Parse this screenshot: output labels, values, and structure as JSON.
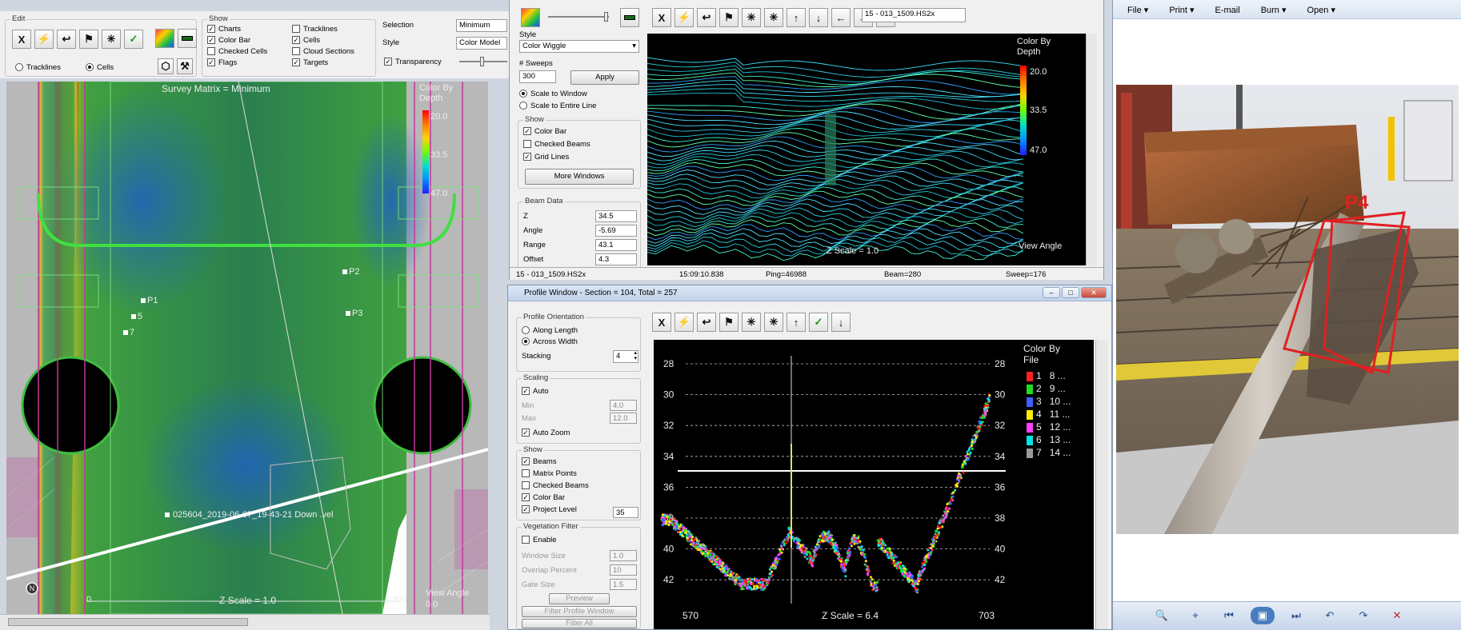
{
  "main_toolbar": {
    "edit_label": "Edit",
    "edit_tools": [
      "X",
      "⚡",
      "↩",
      "⚑",
      "✳",
      "✓"
    ],
    "tracklines_radio": "Tracklines",
    "cells_radio": "Cells",
    "show_label": "Show",
    "show_col1": [
      {
        "label": "Charts",
        "checked": true
      },
      {
        "label": "Color Bar",
        "checked": true
      },
      {
        "label": "Checked Cells",
        "checked": false
      },
      {
        "label": "Flags",
        "checked": true
      }
    ],
    "show_col2": [
      {
        "label": "Tracklines",
        "checked": false
      },
      {
        "label": "Cells",
        "checked": true
      },
      {
        "label": "Cloud Sections",
        "checked": false
      },
      {
        "label": "Targets",
        "checked": true
      }
    ],
    "selection_label": "Selection",
    "selection_value": "Minimum",
    "style_label": "Style",
    "style_value": "Color Model",
    "transparency_label": "Transparency"
  },
  "survey_matrix": {
    "title": "Survey Matrix = Minimum",
    "color_by_title": "Color By\nDepth",
    "colorbar_ticks": [
      "20.0",
      "33.5",
      "47.0"
    ],
    "targets": [
      "P1",
      "P2",
      "P3",
      "5",
      "7"
    ],
    "track_label": "025604_2019-06-07_19-43-21 Down .vel",
    "scale_start": "0",
    "scale_end": "300",
    "z_scale": "Z Scale = 1.0",
    "view_angle_label": "View Angle",
    "view_angle_value": "0.0",
    "north": "N",
    "colors": {
      "seabed": "#2f7a3f",
      "deep": "#1f4fa0",
      "pink_grid": "#c0389a"
    }
  },
  "wiggle_window": {
    "toolbar_tools": [
      "X",
      "⚡",
      "↩",
      "⚑",
      "✳",
      "✳",
      "↑",
      "↓",
      "←",
      "→",
      "⊕"
    ],
    "file_name": "15 - 013_1509.HS2x",
    "style_label": "Style",
    "style_value": "Color Wiggle",
    "sweeps_label": "# Sweeps",
    "sweeps_value": "300",
    "apply_button": "Apply",
    "scale_to_window": "Scale to Window",
    "scale_to_entire_line": "Scale to Entire Line",
    "show_label": "Show",
    "show_items": [
      {
        "label": "Color Bar",
        "checked": true
      },
      {
        "label": "Checked Beams",
        "checked": false
      },
      {
        "label": "Grid Lines",
        "checked": true
      }
    ],
    "more_windows_button": "More Windows",
    "beam_data_label": "Beam Data",
    "beam_data": [
      {
        "label": "Z",
        "value": "34.5"
      },
      {
        "label": "Angle",
        "value": "-5.69"
      },
      {
        "label": "Range",
        "value": "43.1"
      },
      {
        "label": "Offset",
        "value": "4.3"
      }
    ],
    "color_by_title": "Color By\nDepth",
    "colorbar_ticks": [
      "20.0",
      "33.5",
      "47.0"
    ],
    "z_scale": "Z Scale = 1.0",
    "view_angle": "View Angle",
    "status": {
      "file": "15 - 013_1509.HS2x",
      "time": "15:09:10.838",
      "ping": "Ping=46988",
      "beam": "Beam=280",
      "sweep": "Sweep=176"
    }
  },
  "profile_window": {
    "title": "Profile Window - Section = 104, Total = 257",
    "toolbar_tools": [
      "X",
      "⚡",
      "↩",
      "⚑",
      "✳",
      "✳",
      "↑",
      "✓",
      "↓"
    ],
    "orientation_label": "Profile Orientation",
    "along_length": "Along Length",
    "across_width": "Across Width",
    "stacking_label": "Stacking",
    "stacking_value": "4",
    "scaling_label": "Scaling",
    "auto_label": "Auto",
    "min_label": "Min",
    "min_value": "4.0",
    "max_label": "Max",
    "max_value": "12.0",
    "auto_zoom_label": "Auto Zoom",
    "show_label": "Show",
    "show_items": [
      {
        "label": "Beams",
        "checked": true
      },
      {
        "label": "Matrix Points",
        "checked": false
      },
      {
        "label": "Checked Beams",
        "checked": false
      },
      {
        "label": "Color Bar",
        "checked": true
      },
      {
        "label": "Project Level",
        "checked": true
      }
    ],
    "project_level_value": "35",
    "vegetation_label": "Vegetation Filter",
    "enable_label": "Enable",
    "window_size_label": "Window Size",
    "window_size_value": "1.0",
    "overlap_label": "Overlap Percent",
    "overlap_value": "10",
    "gate_size_label": "Gate Size",
    "gate_size_value": "1.5",
    "preview_button": "Preview",
    "filter_profile_button": "Filter Profile Window",
    "filter_all_button": "Filter All",
    "y_ticks": [
      "28",
      "30",
      "32",
      "34",
      "36",
      "38",
      "40",
      "42"
    ],
    "x_start": "570",
    "x_end": "703",
    "z_scale": "Z Scale = 6.4",
    "legend_title": "Color By\nFile",
    "legend": [
      {
        "a": "1",
        "b": "8 ...",
        "color": "#ff2020"
      },
      {
        "a": "2",
        "b": "9 ...",
        "color": "#22dd22"
      },
      {
        "a": "3",
        "b": "10 ...",
        "color": "#4060ff"
      },
      {
        "a": "4",
        "b": "11 ...",
        "color": "#ffee00"
      },
      {
        "a": "5",
        "b": "12 ...",
        "color": "#ff40ff"
      },
      {
        "a": "6",
        "b": "13 ...",
        "color": "#00e5e5"
      },
      {
        "a": "7",
        "b": "14 ...",
        "color": "#9a9a9a"
      }
    ]
  },
  "photo_viewer": {
    "menu": [
      "File",
      "Print",
      "E-mail",
      "Burn",
      "Open"
    ],
    "annotation": "P4",
    "bottom_controls": [
      "🔍",
      "⌖",
      "⏮",
      "▣",
      "⏭",
      "↶",
      "↷",
      "✕"
    ]
  }
}
